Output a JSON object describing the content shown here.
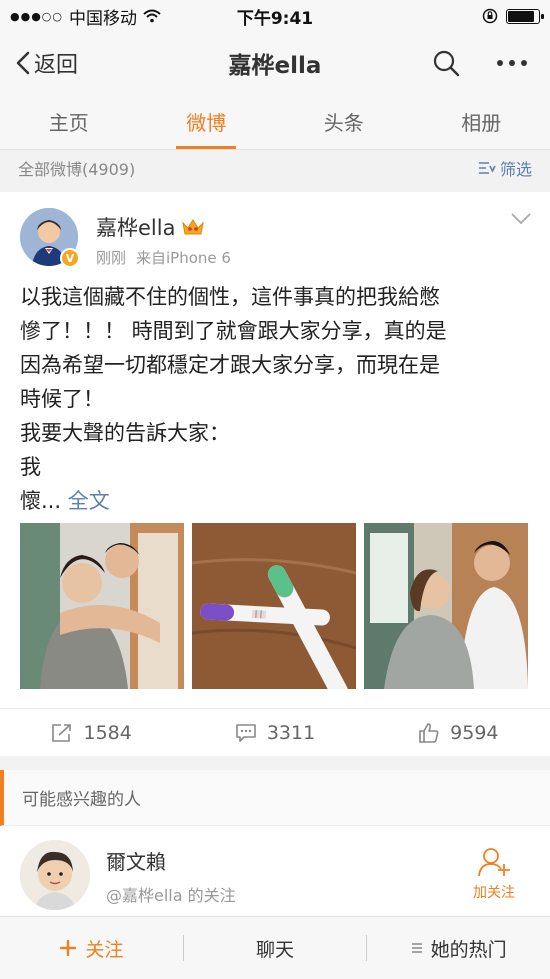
{
  "status_bar": {
    "carrier": "中国移动",
    "time": "下午9:41",
    "battery_level": 0.85
  },
  "nav": {
    "back_label": "返回",
    "title": "嘉桦ella"
  },
  "tabs": [
    {
      "label": "主页"
    },
    {
      "label": "微博"
    },
    {
      "label": "头条"
    },
    {
      "label": "相册"
    }
  ],
  "count_bar": {
    "total": "全部微博(4909)",
    "filter_label": "筛选"
  },
  "post": {
    "username": "嘉桦ella",
    "time": "刚刚",
    "source": "来自iPhone 6",
    "body_lines": [
      "以我這個藏不住的個性，這件事真的把我給憋",
      "慘了！！！ 時間到了就會跟大家分享，真的是",
      "因為希望一切都穩定才跟大家分享，而現在是",
      "時候了！",
      "我要大聲的告訴大家：",
      "我",
      "懷..."
    ],
    "full_text_label": "全文",
    "repost_count": "1584",
    "comment_count": "3311",
    "like_count": "9594"
  },
  "suggest": {
    "header": "可能感兴趣的人",
    "name": "爾文賴",
    "sub": "@嘉桦ella 的关注",
    "follow_label": "加关注"
  },
  "bottom_bar": {
    "follow": "关注",
    "chat": "聊天",
    "hot": "她的热门"
  },
  "colors": {
    "accent": "#f08020",
    "link": "#5b7fb1"
  }
}
